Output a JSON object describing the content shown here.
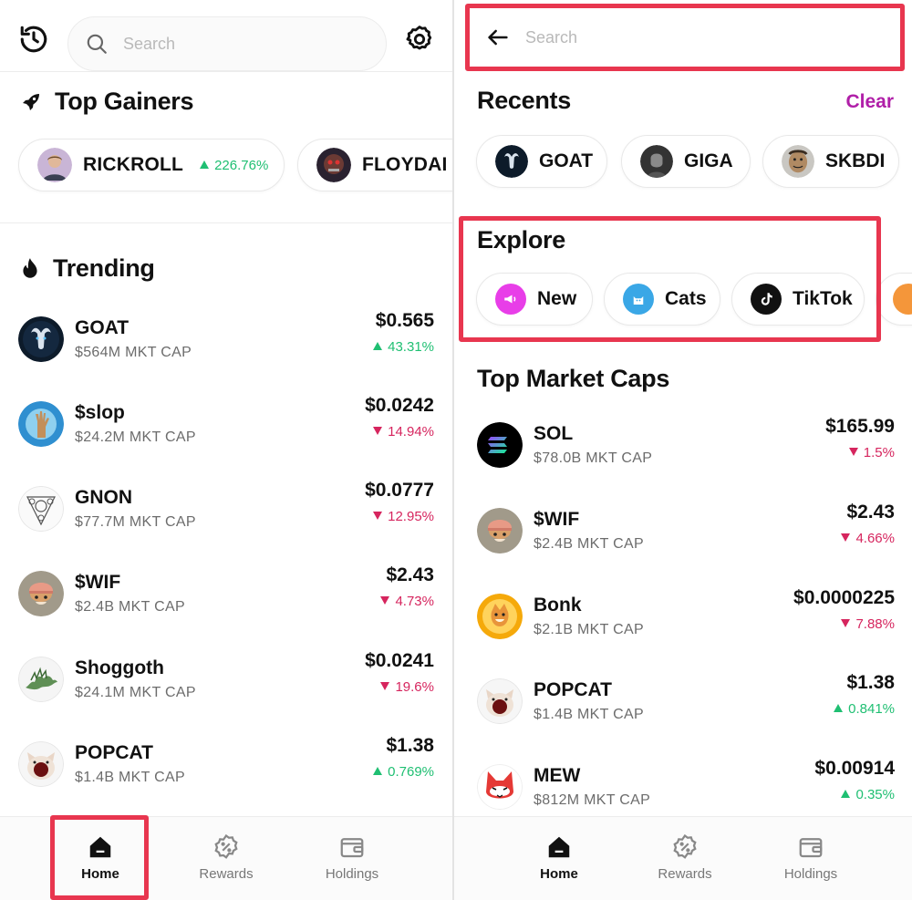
{
  "left": {
    "search": {
      "placeholder": "Search"
    },
    "top_gainers": {
      "title": "Top Gainers",
      "items": [
        {
          "name": "RICKROLL",
          "change": "226.76%",
          "direction": "up"
        },
        {
          "name": "FLOYDAI",
          "change": "",
          "direction": ""
        }
      ]
    },
    "trending": {
      "title": "Trending",
      "tokens": [
        {
          "name": "GOAT",
          "cap": "$564M MKT CAP",
          "price": "$0.565",
          "change": "43.31%",
          "direction": "up"
        },
        {
          "name": "$slop",
          "cap": "$24.2M MKT CAP",
          "price": "$0.0242",
          "change": "14.94%",
          "direction": "down"
        },
        {
          "name": "GNON",
          "cap": "$77.7M MKT CAP",
          "price": "$0.0777",
          "change": "12.95%",
          "direction": "down"
        },
        {
          "name": "$WIF",
          "cap": "$2.4B MKT CAP",
          "price": "$2.43",
          "change": "4.73%",
          "direction": "down"
        },
        {
          "name": "Shoggoth",
          "cap": "$24.1M MKT CAP",
          "price": "$0.0241",
          "change": "19.6%",
          "direction": "down"
        },
        {
          "name": "POPCAT",
          "cap": "$1.4B MKT CAP",
          "price": "$1.38",
          "change": "0.769%",
          "direction": "up"
        }
      ]
    },
    "nav": [
      {
        "label": "Home",
        "icon": "home-icon",
        "active": true
      },
      {
        "label": "Rewards",
        "icon": "rewards-badge-icon",
        "active": false
      },
      {
        "label": "Holdings",
        "icon": "wallet-icon",
        "active": false
      }
    ]
  },
  "right": {
    "search": {
      "placeholder": "Search"
    },
    "recents": {
      "title": "Recents",
      "clear_label": "Clear",
      "items": [
        {
          "name": "GOAT"
        },
        {
          "name": "GIGA"
        },
        {
          "name": "SKBDI"
        }
      ]
    },
    "explore": {
      "title": "Explore",
      "items": [
        {
          "name": "New",
          "icon": "megaphone-icon",
          "color": "#e83ee8"
        },
        {
          "name": "Cats",
          "icon": "cat-icon",
          "color": "#3aa7e6"
        },
        {
          "name": "TikTok",
          "icon": "tiktok-icon",
          "color": "#111111"
        }
      ]
    },
    "top_market_caps": {
      "title": "Top Market Caps",
      "tokens": [
        {
          "name": "SOL",
          "cap": "$78.0B MKT CAP",
          "price": "$165.99",
          "change": "1.5%",
          "direction": "down"
        },
        {
          "name": "$WIF",
          "cap": "$2.4B MKT CAP",
          "price": "$2.43",
          "change": "4.66%",
          "direction": "down"
        },
        {
          "name": "Bonk",
          "cap": "$2.1B MKT CAP",
          "price": "$0.0000225",
          "change": "7.88%",
          "direction": "down"
        },
        {
          "name": "POPCAT",
          "cap": "$1.4B MKT CAP",
          "price": "$1.38",
          "change": "0.841%",
          "direction": "up"
        },
        {
          "name": "MEW",
          "cap": "$812M MKT CAP",
          "price": "$0.00914",
          "change": "0.35%",
          "direction": "up"
        }
      ]
    },
    "nav": [
      {
        "label": "Home",
        "icon": "home-icon",
        "active": true
      },
      {
        "label": "Rewards",
        "icon": "rewards-badge-icon",
        "active": false
      },
      {
        "label": "Holdings",
        "icon": "wallet-icon",
        "active": false
      }
    ]
  },
  "colors": {
    "up": "#1fbf72",
    "down": "#d6255e",
    "accent": "#b01fa8",
    "highlight": "#e8364f"
  }
}
